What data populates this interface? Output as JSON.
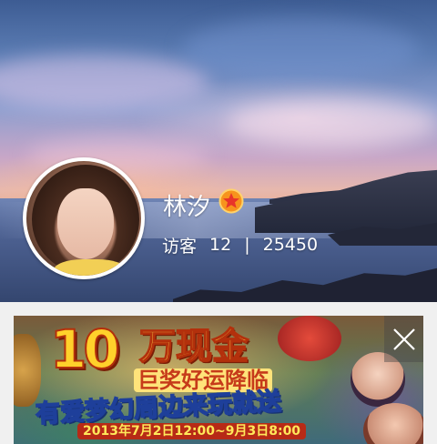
{
  "profile": {
    "name": "林汐",
    "badge_icon": "star-badge-icon",
    "visitors_label": "访客",
    "visitors_today": "12",
    "separator": "|",
    "visitors_total": "25450"
  },
  "banner": {
    "amount": "10",
    "headline": "万现金",
    "subheadline": "巨奖好运降临",
    "tagline": "有爱梦幻周边来玩就送",
    "date_range": "2013年7月2日12:00~9月3日8:00",
    "close_icon": "close-icon"
  },
  "colors": {
    "badge_fill": "#f7941d",
    "badge_star": "#e8352a",
    "page_background": "#f0f0f0"
  }
}
